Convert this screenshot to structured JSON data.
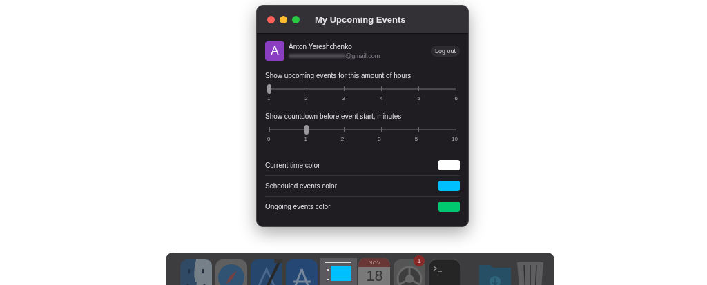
{
  "window": {
    "title": "My Upcoming Events"
  },
  "account": {
    "initial": "A",
    "name": "Anton Yereshchenko",
    "email_domain": "@gmail.com",
    "logout": "Log out"
  },
  "sliders": [
    {
      "label": "Show upcoming events for this amount of hours",
      "ticks": [
        "1",
        "2",
        "3",
        "4",
        "5",
        "6"
      ],
      "level": 0
    },
    {
      "label": "Show countdown before event start, minutes",
      "ticks": [
        "0",
        "1",
        "2",
        "3",
        "5",
        "10"
      ],
      "level": 0.2
    }
  ],
  "colors": [
    {
      "label": "Current time color",
      "color": "#ffffff"
    },
    {
      "label": "Scheduled events color",
      "color": "#00bfff"
    },
    {
      "label": "Ongoing events color",
      "color": "#00c86e"
    }
  ],
  "dock": [
    {
      "kind": "finder",
      "selected": false
    },
    {
      "kind": "safari",
      "selected": false
    },
    {
      "kind": "xcode",
      "selected": false
    },
    {
      "kind": "appstore",
      "selected": false
    },
    {
      "kind": "events",
      "selected": true
    },
    {
      "kind": "calendar",
      "selected": false,
      "month": "NOV",
      "day": "18"
    },
    {
      "kind": "settings",
      "selected": false,
      "badge": "1"
    },
    {
      "kind": "terminal",
      "selected": false
    },
    {
      "kind": "gap"
    },
    {
      "kind": "downloads",
      "selected": false
    },
    {
      "kind": "trash",
      "selected": false
    }
  ]
}
